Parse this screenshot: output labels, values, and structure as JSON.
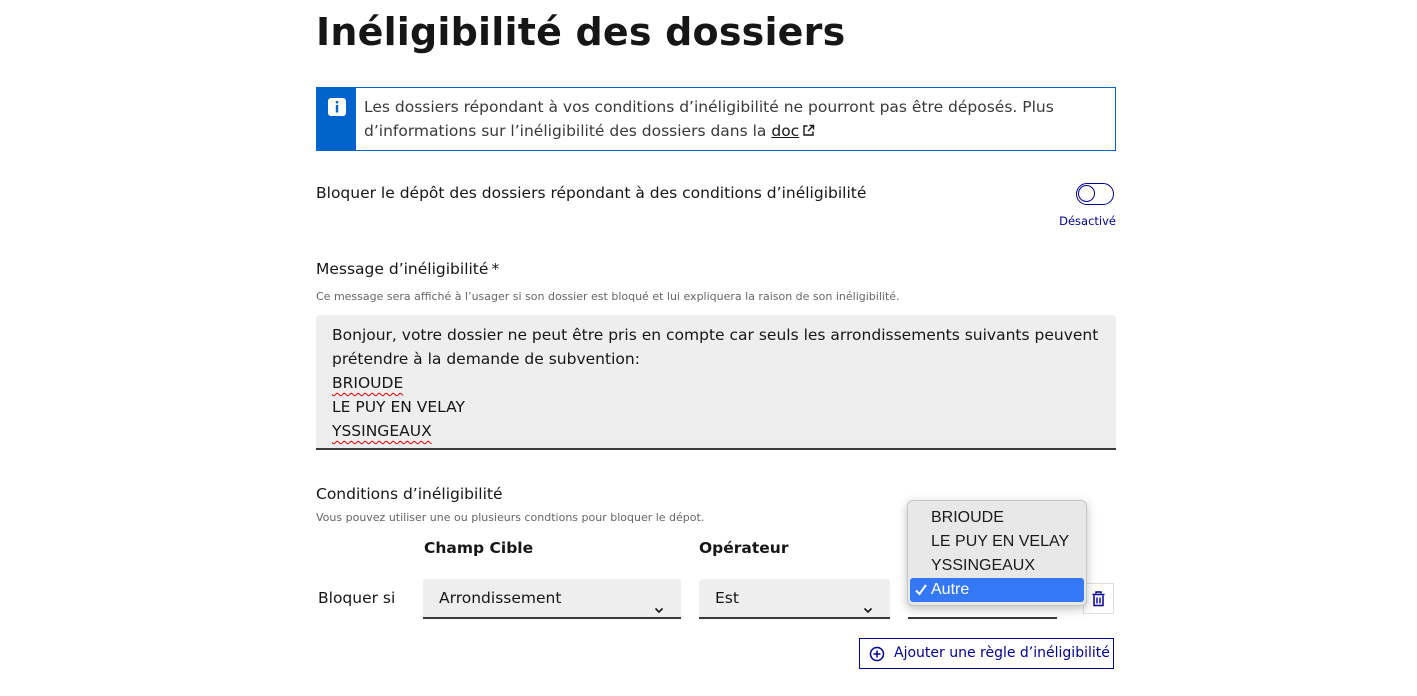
{
  "page": {
    "title": "Inéligibilité des dossiers"
  },
  "notice": {
    "text": "Les dossiers répondant à vos conditions d’inéligibilité ne pourront pas être déposés. Plus d’informations sur l’inéligibilité des dossiers dans la ",
    "link_label": "doc",
    "icon": "info-icon",
    "accent_color": "#0063cb"
  },
  "toggle": {
    "label": "Bloquer le dépôt des dossiers répondant à des conditions d’inéligibilité",
    "status": "Désactivé",
    "checked": false,
    "accent_color": "#000091"
  },
  "message_field": {
    "label": "Message d’inéligibilité",
    "required_mark": "*",
    "hint": "Ce message sera affiché à l’usager si son dossier est bloqué et lui expliquera la raison de son inéligibilité.",
    "value_lines": [
      "Bonjour, votre dossier ne peut être pris en compte car seuls les arrondissements suivants peuvent",
      "prétendre à la demande de subvention:",
      "BRIOUDE",
      "LE PUY EN VELAY",
      "YSSINGEAUX"
    ]
  },
  "conditions": {
    "title": "Conditions d’inéligibilité",
    "hint": "Vous pouvez utiliser une ou plusieurs condtions pour bloquer le dépot.",
    "columns": {
      "target": "Champ Cible",
      "operator": "Opérateur"
    },
    "row": {
      "label": "Bloquer si",
      "target_value": "Arrondissement",
      "operator_value": "Est"
    },
    "value_dropdown": {
      "options": [
        "BRIOUDE",
        "LE PUY EN VELAY",
        "YSSINGEAUX",
        "Autre"
      ],
      "selected": "Autre",
      "highlight_color": "#3478f6"
    },
    "add_button": "Ajouter une règle d’inéligibilité"
  }
}
